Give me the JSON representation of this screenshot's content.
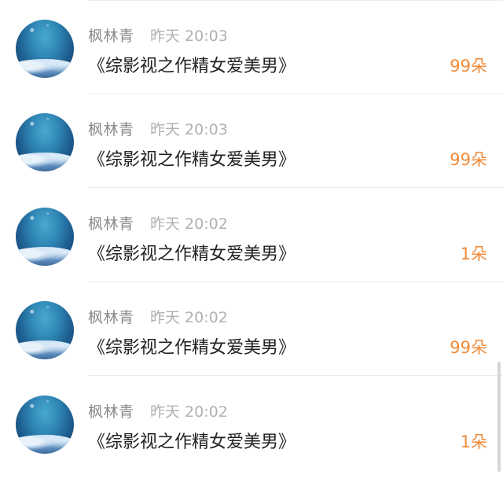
{
  "items": [
    {
      "name": "枫林青",
      "time": "昨天 20:03",
      "title": "《综影视之作精女爱美男》",
      "count": "99朵"
    },
    {
      "name": "枫林青",
      "time": "昨天 20:03",
      "title": "《综影视之作精女爱美男》",
      "count": "99朵"
    },
    {
      "name": "枫林青",
      "time": "昨天 20:02",
      "title": "《综影视之作精女爱美男》",
      "count": "1朵"
    },
    {
      "name": "枫林青",
      "time": "昨天 20:02",
      "title": "《综影视之作精女爱美男》",
      "count": "99朵"
    },
    {
      "name": "枫林青",
      "time": "昨天 20:02",
      "title": "《综影视之作精女爱美男》",
      "count": "1朵"
    }
  ],
  "colors": {
    "accent": "#f08a38",
    "name_text": "#8a8a8a",
    "time_text": "#b0b0b0",
    "title_text": "#222222",
    "divider": "#ececec"
  }
}
